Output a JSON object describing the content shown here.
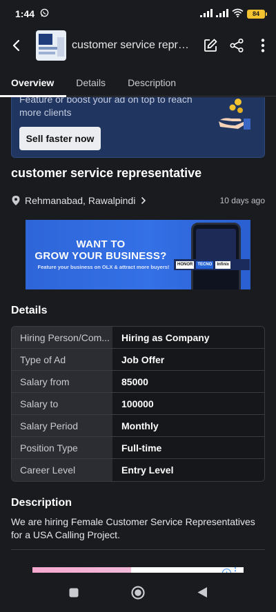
{
  "status_bar": {
    "time": "1:44",
    "battery": "84"
  },
  "app_bar": {
    "title": "customer service represe..."
  },
  "tabs": [
    {
      "label": "Overview"
    },
    {
      "label": "Details"
    },
    {
      "label": "Description"
    }
  ],
  "promo": {
    "text": "Feature or boost your ad on top to reach more clients",
    "button_label": "Sell faster now"
  },
  "ad": {
    "title": "customer service representative",
    "location": "Rehmanabad, Rawalpindi",
    "posted": "10 days ago"
  },
  "banner": {
    "line1": "WANT TO",
    "line2": "GROW YOUR BUSINESS?",
    "sub": "Feature your business on OLX & attract more buyers!",
    "brands": [
      "HONOR",
      "TECNO",
      "Infinix"
    ]
  },
  "details": {
    "heading": "Details",
    "rows": [
      {
        "key": "Hiring Person/Com...",
        "value": "Hiring as Company"
      },
      {
        "key": "Type of Ad",
        "value": "Job Offer"
      },
      {
        "key": "Salary from",
        "value": "85000"
      },
      {
        "key": "Salary to",
        "value": "100000"
      },
      {
        "key": "Salary Period",
        "value": "Monthly"
      },
      {
        "key": "Position Type",
        "value": "Full-time"
      },
      {
        "key": "Career Level",
        "value": "Entry Level"
      }
    ]
  },
  "description": {
    "heading": "Description",
    "text": "We are hiring Female Customer Service Representatives for a USA Calling Project."
  },
  "colors": {
    "background": "#1a1b1f",
    "promo_bg": "#20355f",
    "banner_blue": "#3470e6",
    "table_key_bg": "#2c2d33"
  }
}
